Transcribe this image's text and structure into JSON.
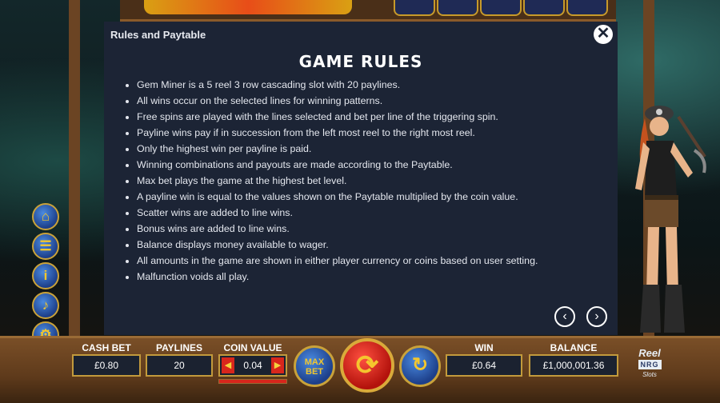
{
  "dialog": {
    "title": "Rules and Paytable",
    "heading": "GAME RULES",
    "rules": [
      "Gem Miner is a 5 reel 3 row cascading slot with 20 paylines.",
      "All wins occur on the selected lines for winning patterns.",
      "Free spins are played with the lines selected and bet per line of the triggering spin.",
      "Payline wins pay if in succession from the left most reel to the right most reel.",
      "Only the highest win per payline is paid.",
      "Winning combinations and payouts are made according to the Paytable.",
      "Max bet plays the game at the highest bet level.",
      "A payline win is equal to the values shown on the Paytable multiplied by the coin value.",
      "Scatter wins are added to line wins.",
      "Bonus wins are added to line wins.",
      "Balance displays money available to wager.",
      "All amounts in the game are shown in either player currency or coins based on user setting.",
      "Malfunction voids all play."
    ],
    "close_icon": "✕",
    "prev_icon": "‹",
    "next_icon": "›"
  },
  "side_menu": {
    "home_icon": "⌂",
    "paytable_icon": "☰",
    "info_icon": "i",
    "sound_icon": "♪",
    "settings_icon": "⚙",
    "exit_icon": "✕"
  },
  "bottom": {
    "cash_bet_label": "CASH BET",
    "cash_bet_value": "£0.80",
    "paylines_label": "PAYLINES",
    "paylines_value": "20",
    "coin_value_label": "COIN VALUE",
    "coin_value": "0.04",
    "coin_left_icon": "◀",
    "coin_right_icon": "▶",
    "coin_level_fraction": 1.0,
    "max_bet_line1": "MAX",
    "max_bet_line2": "BET",
    "spin_icon": "⟳",
    "autoplay_icon": "↻",
    "win_label": "WIN",
    "win_value": "£0.64",
    "balance_label": "BALANCE",
    "balance_value": "£1,000,001.36"
  },
  "brand": {
    "line1": "Reel",
    "line2": "NRG",
    "line3": "Slots"
  },
  "colors": {
    "dialog_bg": "#1c2435",
    "wood": "#6b4423",
    "gold_border": "#c29a3c",
    "spin_red": "#d8261c",
    "button_blue": "#1d3f8a"
  }
}
